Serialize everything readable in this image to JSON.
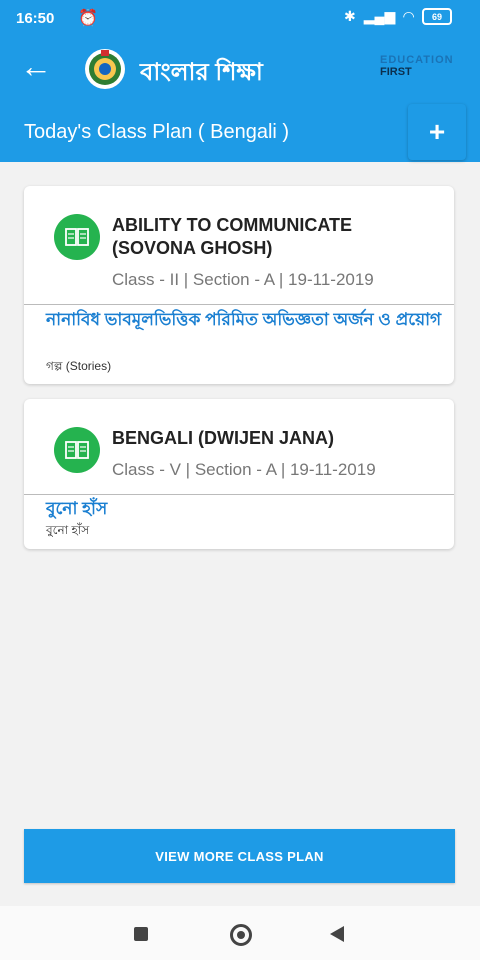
{
  "status": {
    "time": "16:50",
    "battery": "69",
    "alarm_icon": "alarm-icon",
    "bt_icon": "bluetooth-icon",
    "wifi_icon": "wifi-icon"
  },
  "app_bar": {
    "title": "বাংলার শিক্ষা",
    "brand_top": "EDUCATION",
    "brand_bottom": "FIRST",
    "back_icon": "←"
  },
  "sub_bar": {
    "title": "Today's Class Plan ( Bengali )",
    "add_label": "+"
  },
  "cards": [
    {
      "subject": "ABILITY TO COMMUNICATE (SOVONA  GHOSH)",
      "meta": "Class - II | Section - A | 19-11-2019",
      "topic": "নানাবিধ ভাবমূলভিত্তিক পরিমিত অভিজ্ঞতা অর্জন ও প্রয়োগ",
      "topic_sub": "গল্প (Stories)"
    },
    {
      "subject": "BENGALI (DWIJEN  JANA)",
      "meta": "Class - V | Section - A | 19-11-2019",
      "topic": "বুনো হাঁস",
      "topic_sub": "বুনো হাঁস"
    }
  ],
  "footer": {
    "view_more": "VIEW MORE CLASS PLAN"
  },
  "colors": {
    "primary": "#1e9be6",
    "accent_green": "#25b34f",
    "topic_blue": "#1a7fd1"
  }
}
